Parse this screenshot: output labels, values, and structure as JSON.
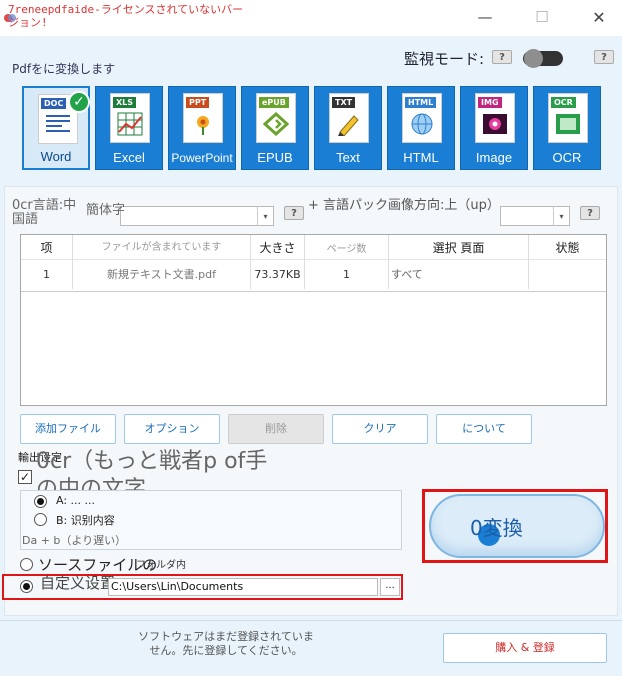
{
  "window": {
    "title": "7reneepdfaide-ライセンスされていないバージョン!",
    "minimize": "—",
    "maximize": "☐",
    "close": "✕"
  },
  "header": {
    "convert_to": "Pdfをに変換します",
    "monitor_mode": "監視モード:",
    "help": "?",
    "monitor_on": false
  },
  "formats": [
    {
      "label": "Word",
      "tag": "DOC",
      "color": "#2b5fb3",
      "active": true
    },
    {
      "label": "Excel",
      "tag": "XLS",
      "color": "#1e7d3a",
      "active": false
    },
    {
      "label": "PowerPoint",
      "tag": "PPT",
      "color": "#c84c1e",
      "active": false
    },
    {
      "label": "EPUB",
      "tag": "ePUB",
      "color": "#6aa32c",
      "active": false
    },
    {
      "label": "Text",
      "tag": "TXT",
      "color": "#333333",
      "active": false
    },
    {
      "label": "HTML",
      "tag": "HTML",
      "color": "#2f7fd0",
      "active": false
    },
    {
      "label": "Image",
      "tag": "IMG",
      "color": "#c0267e",
      "active": false
    },
    {
      "label": "OCR",
      "tag": "OCR",
      "color": "#2a9d4a",
      "active": false
    }
  ],
  "ocr": {
    "language_label": "0cr言語:中国語",
    "language_value": "簡体字",
    "direction_label": "+ 言語パック画像方向:上（up）",
    "arrow": "▾"
  },
  "table": {
    "headers": [
      "项",
      "ファイルが含まれています",
      "大きさ",
      "ページ数",
      "選択 頁面",
      "状態"
    ],
    "rows": [
      {
        "index": "1",
        "file": "新規テキスト文書.pdf",
        "size": "73.37KB",
        "pages": "1",
        "selected": "すべて",
        "status": ""
      }
    ]
  },
  "actions": {
    "add": "添加ファイル",
    "options": "オプション",
    "delete": "削除",
    "clear": "クリア",
    "about": "について"
  },
  "output": {
    "label": "輸出设定",
    "check": "✓",
    "ocr_text": "0cr（もっと戦者p of手の中の文字",
    "mode_a": "A: ... ...",
    "mode_b": "B: 识别内容",
    "mode_b_note": "Da + b（より遅い）",
    "source_folder": "ソースファイルの",
    "source_folder_small": "フォルダ内",
    "custom_folder": "自定义设置",
    "path": "C:\\Users\\Lin\\Documents",
    "browse": "..."
  },
  "convert": {
    "label": "0変換"
  },
  "footer": {
    "register_text": "ソフトウェアはまだ登録されていません。先に登録してください。",
    "buy": "購入 & 登録"
  }
}
